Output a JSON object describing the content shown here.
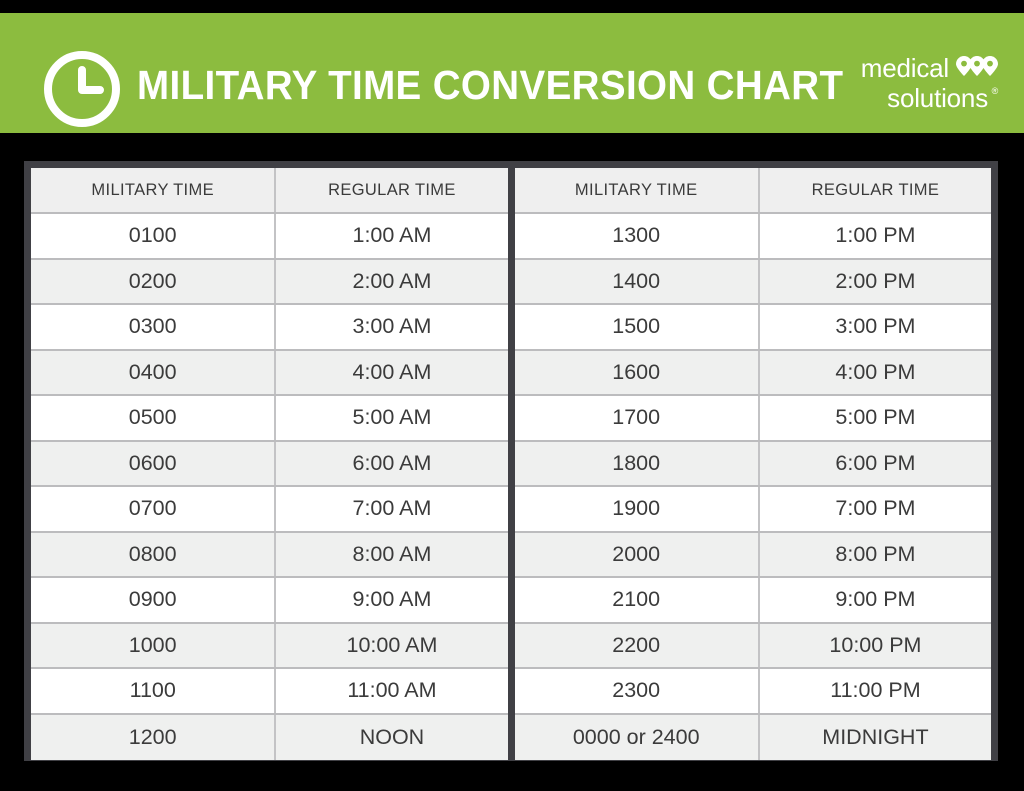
{
  "banner": {
    "title": "MILITARY TIME CONVERSION CHART",
    "clock_icon": "clock-icon",
    "background_color": "#8cbc3f",
    "text_color": "#ffffff",
    "brand": {
      "line1": "medical",
      "line2": "solutions",
      "trademark": "®",
      "mark_icon": "three-map-pins-icon"
    }
  },
  "table": {
    "headers": [
      "MILITARY TIME",
      "REGULAR TIME",
      "MILITARY TIME",
      "REGULAR TIME"
    ],
    "left": {
      "headers": [
        "MILITARY TIME",
        "REGULAR TIME"
      ],
      "rows": [
        [
          "0100",
          "1:00 AM"
        ],
        [
          "0200",
          "2:00 AM"
        ],
        [
          "0300",
          "3:00 AM"
        ],
        [
          "0400",
          "4:00 AM"
        ],
        [
          "0500",
          "5:00 AM"
        ],
        [
          "0600",
          "6:00 AM"
        ],
        [
          "0700",
          "7:00 AM"
        ],
        [
          "0800",
          "8:00 AM"
        ],
        [
          "0900",
          "9:00 AM"
        ],
        [
          "1000",
          "10:00 AM"
        ],
        [
          "1100",
          "11:00 AM"
        ],
        [
          "1200",
          "NOON"
        ]
      ]
    },
    "right": {
      "headers": [
        "MILITARY TIME",
        "REGULAR TIME"
      ],
      "rows": [
        [
          "1300",
          "1:00 PM"
        ],
        [
          "1400",
          "2:00 PM"
        ],
        [
          "1500",
          "3:00 PM"
        ],
        [
          "1600",
          "4:00 PM"
        ],
        [
          "1700",
          "5:00 PM"
        ],
        [
          "1800",
          "6:00 PM"
        ],
        [
          "1900",
          "7:00 PM"
        ],
        [
          "2000",
          "8:00 PM"
        ],
        [
          "2100",
          "9:00 PM"
        ],
        [
          "2200",
          "10:00 PM"
        ],
        [
          "2300",
          "11:00 PM"
        ],
        [
          "0000 or 2400",
          "MIDNIGHT"
        ]
      ]
    },
    "colors": {
      "frame": "#404045",
      "header_background": "#efefef",
      "row_background": "#ffffff",
      "row_alt_background": "#eff0ef",
      "row_divider": "#bcbcbe",
      "column_divider": "#c3c3c5",
      "text": "#3b3b3b"
    }
  },
  "page": {
    "background_color": "#000000"
  }
}
